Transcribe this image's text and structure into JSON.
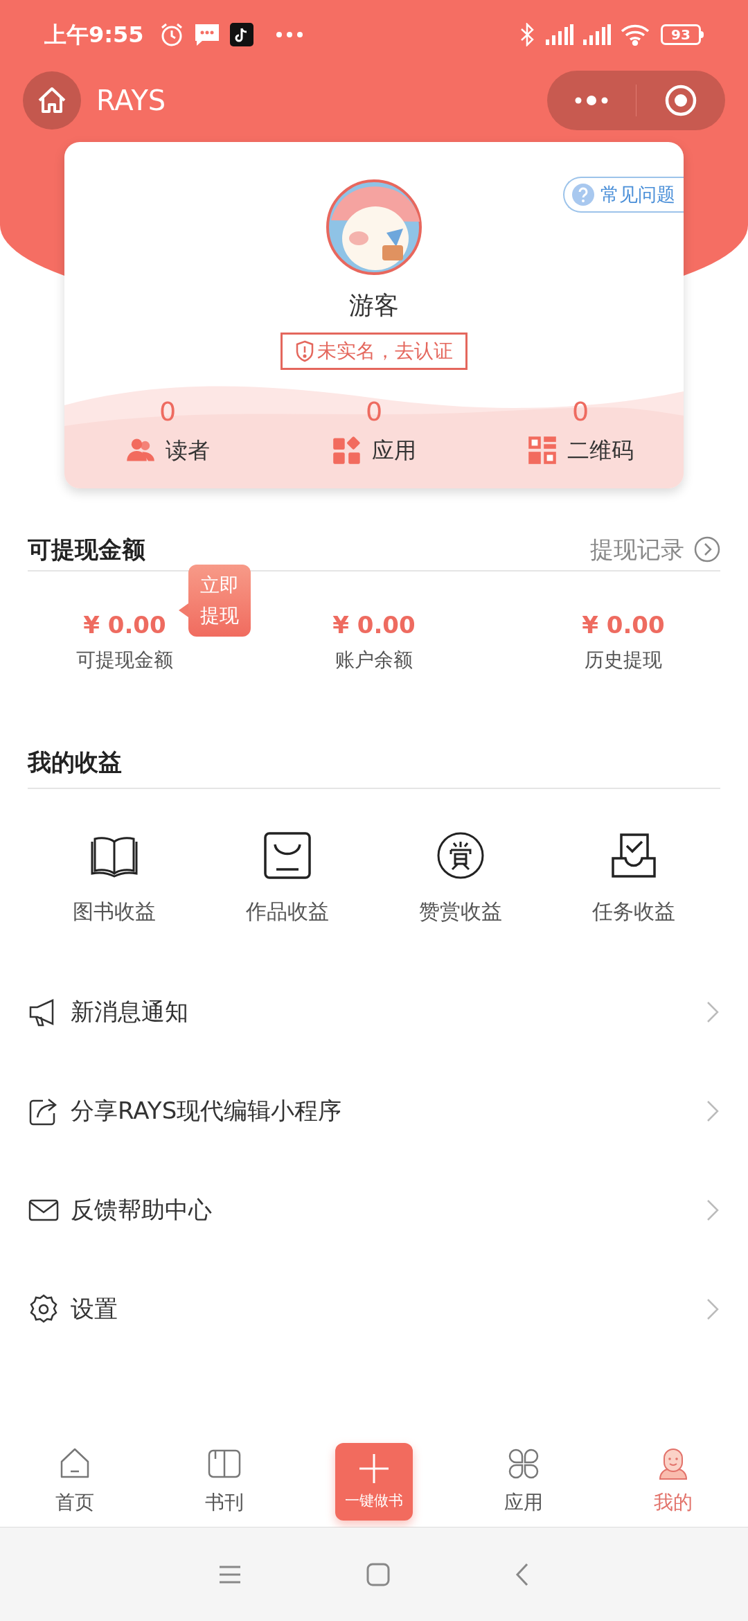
{
  "status_bar": {
    "time": "上午9:55",
    "battery": "93"
  },
  "header": {
    "title": "RAYS"
  },
  "profile": {
    "faq": "常见问题",
    "name": "游客",
    "verify": "未实名，去认证",
    "stats": [
      {
        "value": "0",
        "label": "读者"
      },
      {
        "value": "0",
        "label": "应用"
      },
      {
        "value": "0",
        "label": "二维码"
      }
    ]
  },
  "withdraw": {
    "title": "可提现金额",
    "link": "提现记录",
    "action": "立即提现",
    "amounts": [
      {
        "value": "¥ 0.00",
        "label": "可提现金额"
      },
      {
        "value": "¥ 0.00",
        "label": "账户余额"
      },
      {
        "value": "¥ 0.00",
        "label": "历史提现"
      }
    ]
  },
  "earnings": {
    "title": "我的收益",
    "items": [
      {
        "label": "图书收益"
      },
      {
        "label": "作品收益"
      },
      {
        "label": "赞赏收益"
      },
      {
        "label": "任务收益"
      }
    ]
  },
  "menu": [
    {
      "label": "新消息通知"
    },
    {
      "label": "分享RAYS现代编辑小程序"
    },
    {
      "label": "反馈帮助中心"
    },
    {
      "label": "设置"
    }
  ],
  "tabbar": [
    {
      "label": "首页",
      "kind": "tab",
      "selected": false
    },
    {
      "label": "书刊",
      "kind": "tab",
      "selected": false
    },
    {
      "label": "一键做书",
      "kind": "action",
      "selected": false
    },
    {
      "label": "应用",
      "kind": "tab",
      "selected": false
    },
    {
      "label": "我的",
      "kind": "tab",
      "selected": true
    }
  ]
}
